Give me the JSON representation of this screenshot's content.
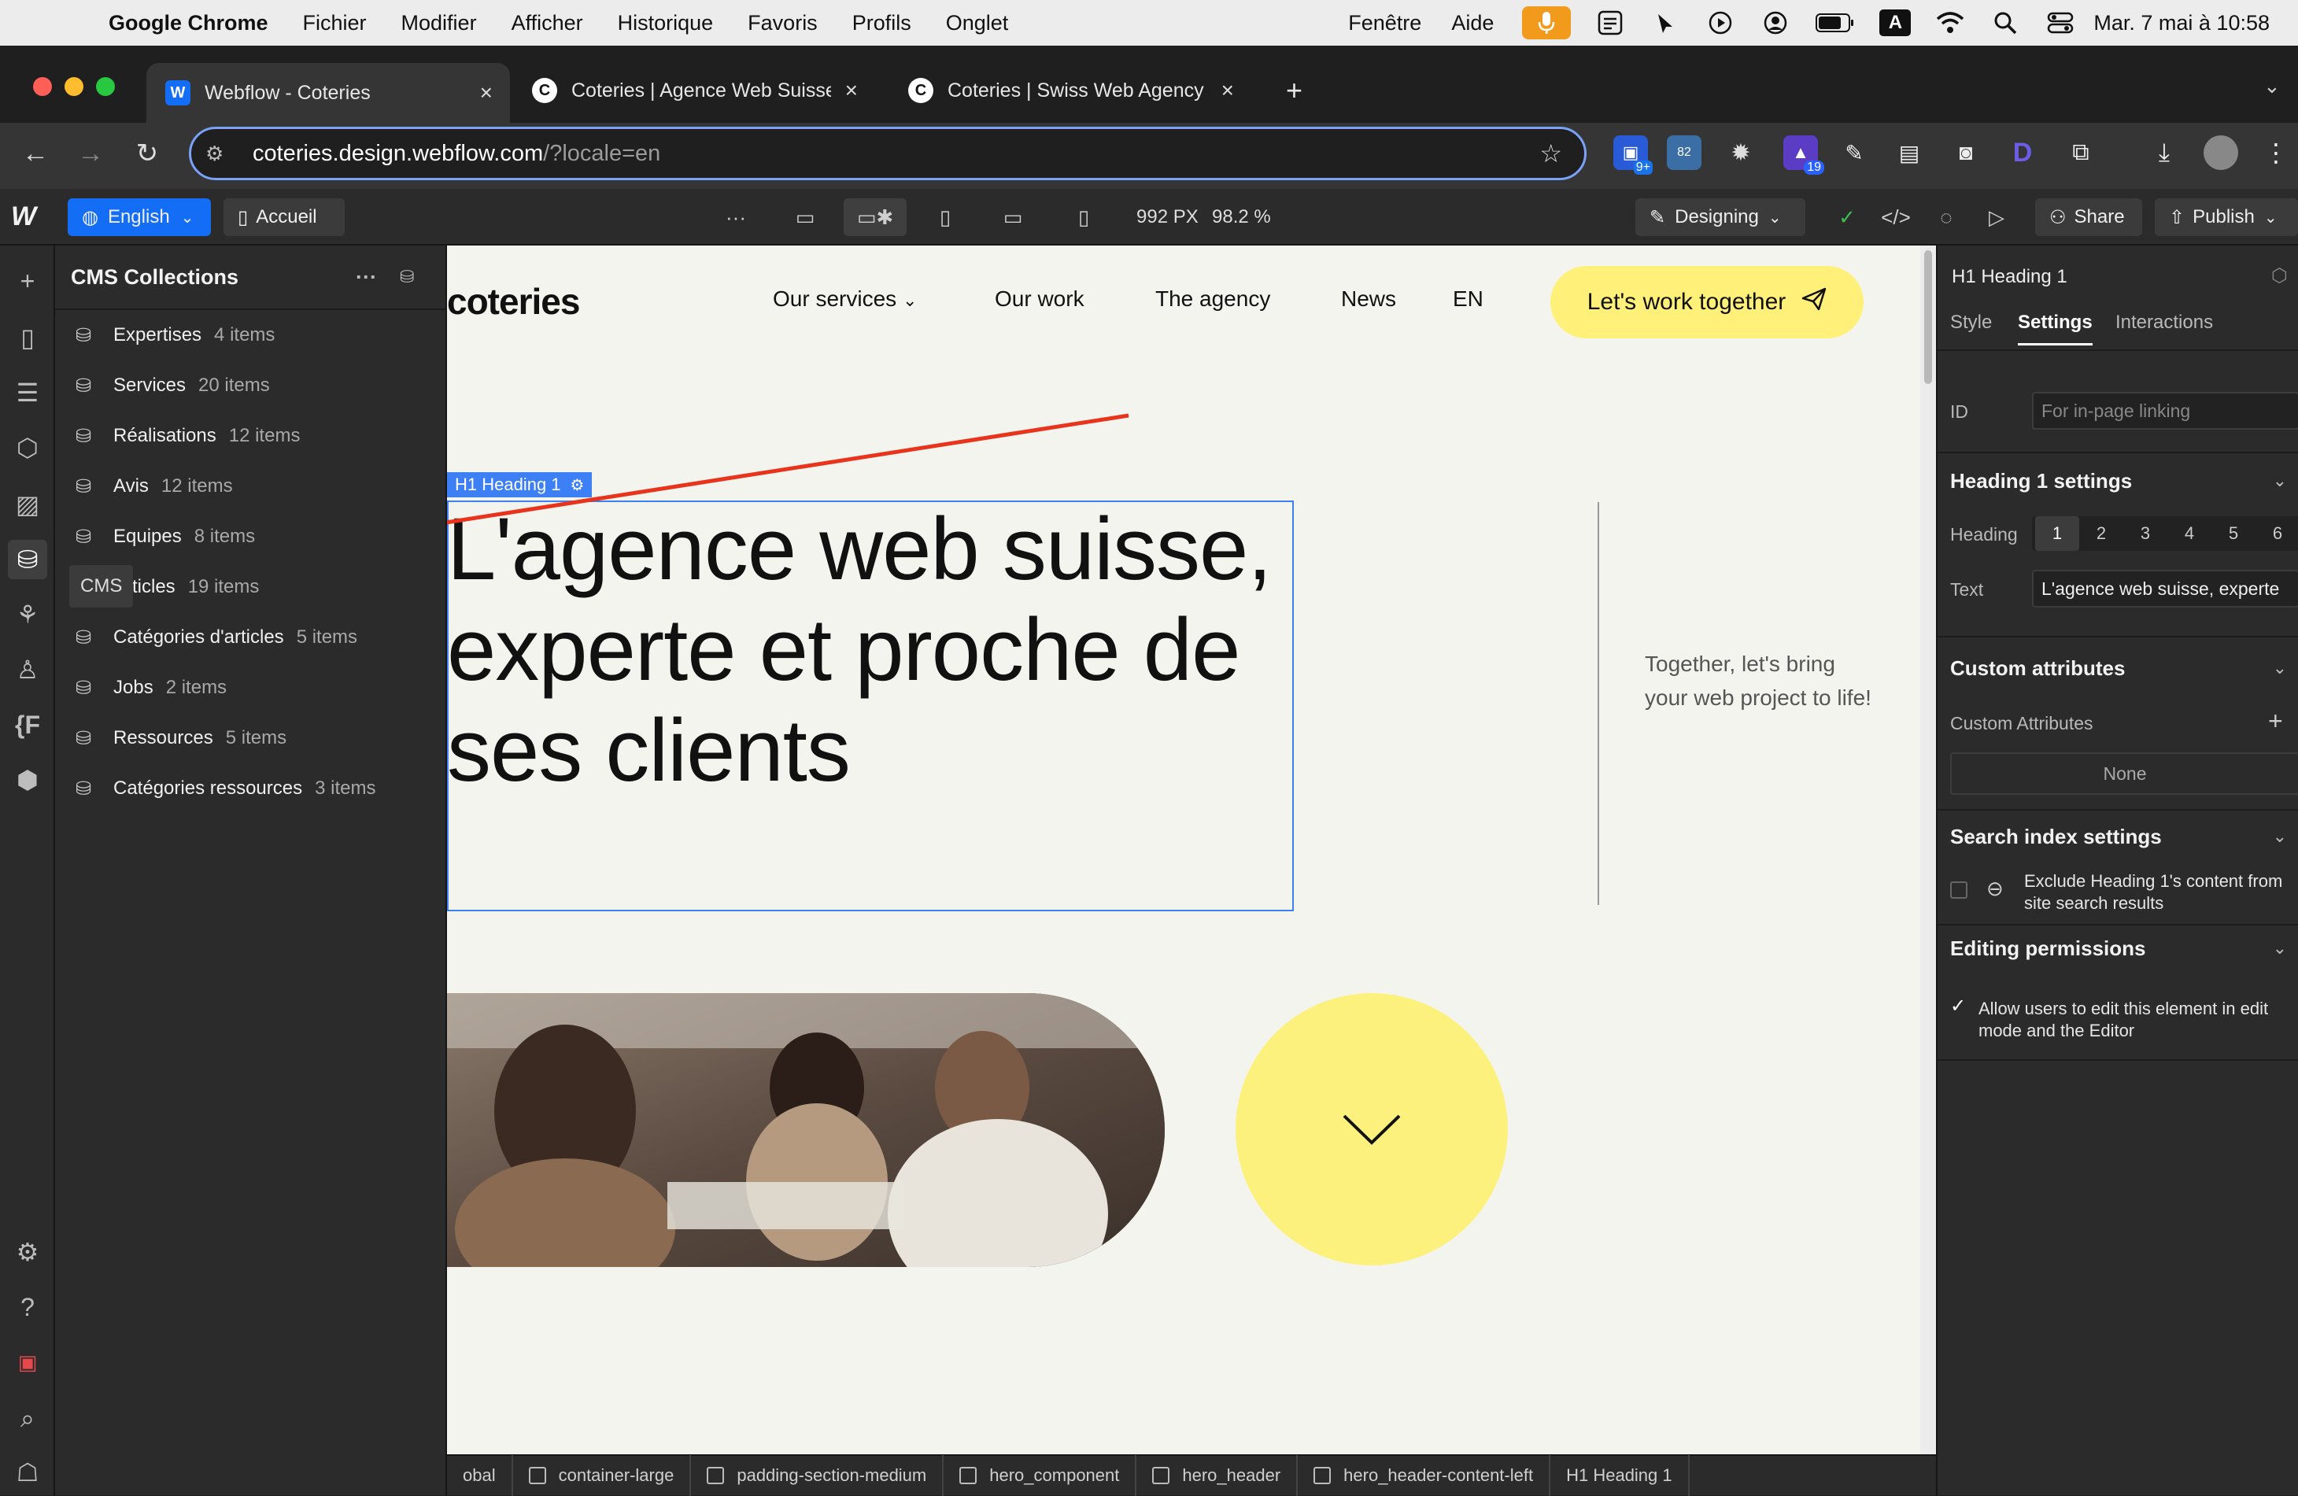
{
  "menubar": {
    "app": "Google Chrome",
    "items": [
      "Fichier",
      "Modifier",
      "Afficher",
      "Historique",
      "Favoris",
      "Profils",
      "Onglet"
    ],
    "right_items": [
      "Fenêtre",
      "Aide"
    ],
    "clock": "Mar. 7 mai à 10:58",
    "input_badge": "A"
  },
  "chrome": {
    "tabs": [
      {
        "title": "Webflow - Coteries",
        "favicon": "W",
        "close": "×"
      },
      {
        "title": "Coteries | Agence Web Suisse",
        "favicon": "C",
        "close": "×"
      },
      {
        "title": "Coteries | Swiss Web Agency",
        "favicon": "C",
        "close": "×"
      }
    ],
    "new_tab": "+",
    "url_host": "coteries.design.webflow.com",
    "url_path": "/?locale=en",
    "extension_badges": [
      "9+",
      "82",
      "19"
    ]
  },
  "webflow_bar": {
    "logo": "W",
    "locale": "English",
    "page": "Accueil",
    "more": "···",
    "width_px": "992 PX",
    "zoom": "98.2 %",
    "mode": "Designing",
    "share": "Share",
    "publish": "Publish"
  },
  "cms": {
    "title": "CMS Collections",
    "tooltip": "CMS",
    "collections": [
      {
        "name": "Expertises",
        "count": "4 items"
      },
      {
        "name": "Services",
        "count": "20 items"
      },
      {
        "name": "Réalisations",
        "count": "12 items"
      },
      {
        "name": "Avis",
        "count": "12 items"
      },
      {
        "name": "Equipes",
        "count": "8 items"
      },
      {
        "name": "Articles",
        "count": "19 items"
      },
      {
        "name": "Catégories d'articles",
        "count": "5 items"
      },
      {
        "name": "Jobs",
        "count": "2 items"
      },
      {
        "name": "Ressources",
        "count": "5 items"
      },
      {
        "name": "Catégories ressources",
        "count": "3 items"
      }
    ]
  },
  "site": {
    "logo": "coteries",
    "nav": [
      "Our services",
      "Our work",
      "The agency",
      "News",
      "EN"
    ],
    "cta": "Let's work together",
    "selection_tag": "H1  Heading 1",
    "headline": "L'agence web suisse, experte et proche de ses clients",
    "side_text": "Together, let's bring your web project to life!"
  },
  "breadcrumbs": [
    "obal",
    "container-large",
    "padding-section-medium",
    "hero_component",
    "hero_header",
    "hero_header-content-left",
    "H1  Heading 1"
  ],
  "settings": {
    "element": "H1  Heading 1",
    "tabs": [
      "Style",
      "Settings",
      "Interactions"
    ],
    "id_label": "ID",
    "id_placeholder": "For in-page linking",
    "heading_section": "Heading 1 settings",
    "heading_label": "Heading",
    "levels": [
      "1",
      "2",
      "3",
      "4",
      "5",
      "6"
    ],
    "text_label": "Text",
    "text_value": "L'agence web suisse, experte",
    "custom_attr_section": "Custom attributes",
    "custom_attr_label": "Custom Attributes",
    "custom_attr_value": "None",
    "search_section": "Search index settings",
    "search_text": "Exclude Heading 1's content from site search results",
    "perm_section": "Editing permissions",
    "perm_text": "Allow users to edit this element in edit mode and the Editor"
  }
}
